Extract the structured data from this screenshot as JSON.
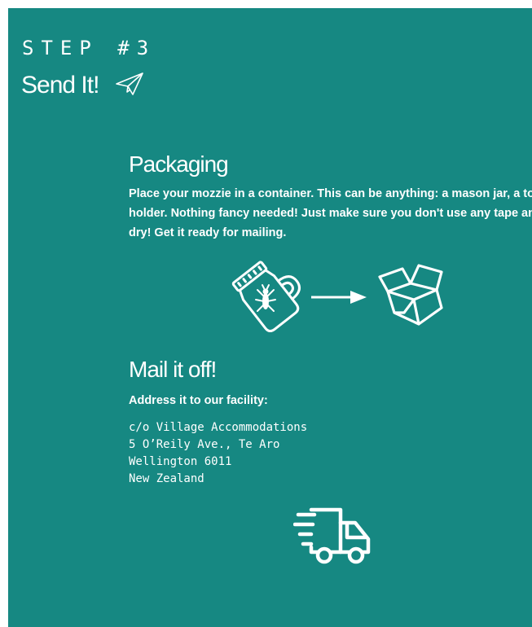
{
  "header": {
    "step_label": "STEP #3",
    "title": "Send It!",
    "title_icon": "paper-plane-icon"
  },
  "packaging": {
    "heading": "Packaging",
    "lines": [
      "Place your mozzie in a container. This can be anything: a mason jar, a toothpick",
      "holder. Nothing fancy needed! Just make sure you don't use any tape and keep it",
      "dry! Get it ready for mailing."
    ],
    "illustration": [
      "mason-jar-mosquito-icon",
      "arrow-right-icon",
      "box-icon"
    ]
  },
  "mail": {
    "heading": "Mail it off!",
    "intro": "Address it to our facility:",
    "address": [
      "c/o Village Accommodations",
      "5 O’Reily Ave., Te Aro",
      "Wellington 6011",
      "New Zealand"
    ],
    "icon": "delivery-truck-icon"
  },
  "colors": {
    "background": "#168882",
    "text": "#ffffff"
  }
}
